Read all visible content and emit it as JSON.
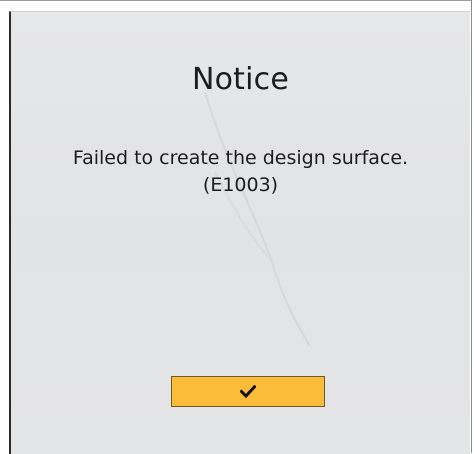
{
  "dialog": {
    "title": "Notice",
    "message_line1": "Failed to create the design surface.",
    "message_line2": "(E1003)",
    "confirm_icon": "checkmark-icon"
  },
  "colors": {
    "panel_background": "#e4e5e7",
    "button_background": "#fbbc3a",
    "text": "#1c1c1c"
  }
}
